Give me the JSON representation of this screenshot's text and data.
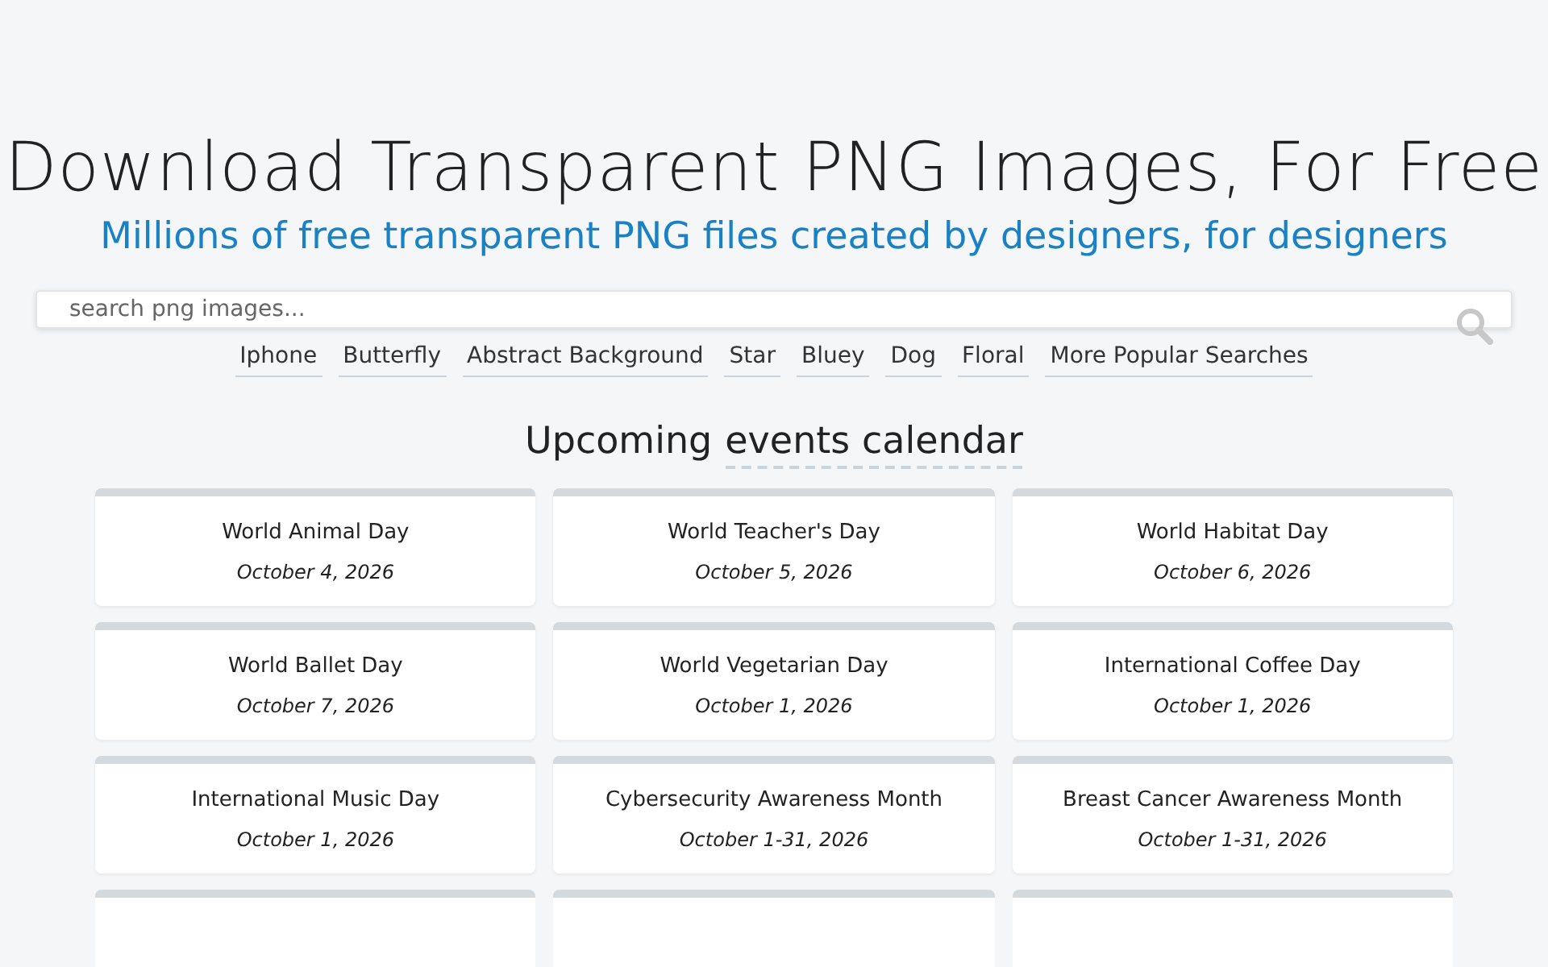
{
  "title": "Download Transparent PNG Images, For Free",
  "subtitle": "Millions of free transparent PNG files created by designers, for designers",
  "search": {
    "placeholder": "search png images..."
  },
  "popular_searches": [
    "Iphone",
    "Butterfly",
    "Abstract Background",
    "Star",
    "Bluey",
    "Dog",
    "Floral",
    "More Popular Searches"
  ],
  "calendar": {
    "heading": "Upcoming",
    "heading_link": "events calendar",
    "events": [
      {
        "name": "World Animal Day",
        "date": "October 4, 2026"
      },
      {
        "name": "World Teacher's Day",
        "date": "October 5, 2026"
      },
      {
        "name": "World Habitat Day",
        "date": "October 6, 2026"
      },
      {
        "name": "World Ballet Day",
        "date": "October 7, 2026"
      },
      {
        "name": "World Vegetarian Day",
        "date": "October 1, 2026"
      },
      {
        "name": "International Coffee Day",
        "date": "October 1, 2026"
      },
      {
        "name": "International Music Day",
        "date": "October 1, 2026"
      },
      {
        "name": "Cybersecurity Awareness Month",
        "date": "October 1-31, 2026"
      },
      {
        "name": "Breast Cancer Awareness Month",
        "date": "October 1-31, 2026"
      }
    ]
  }
}
